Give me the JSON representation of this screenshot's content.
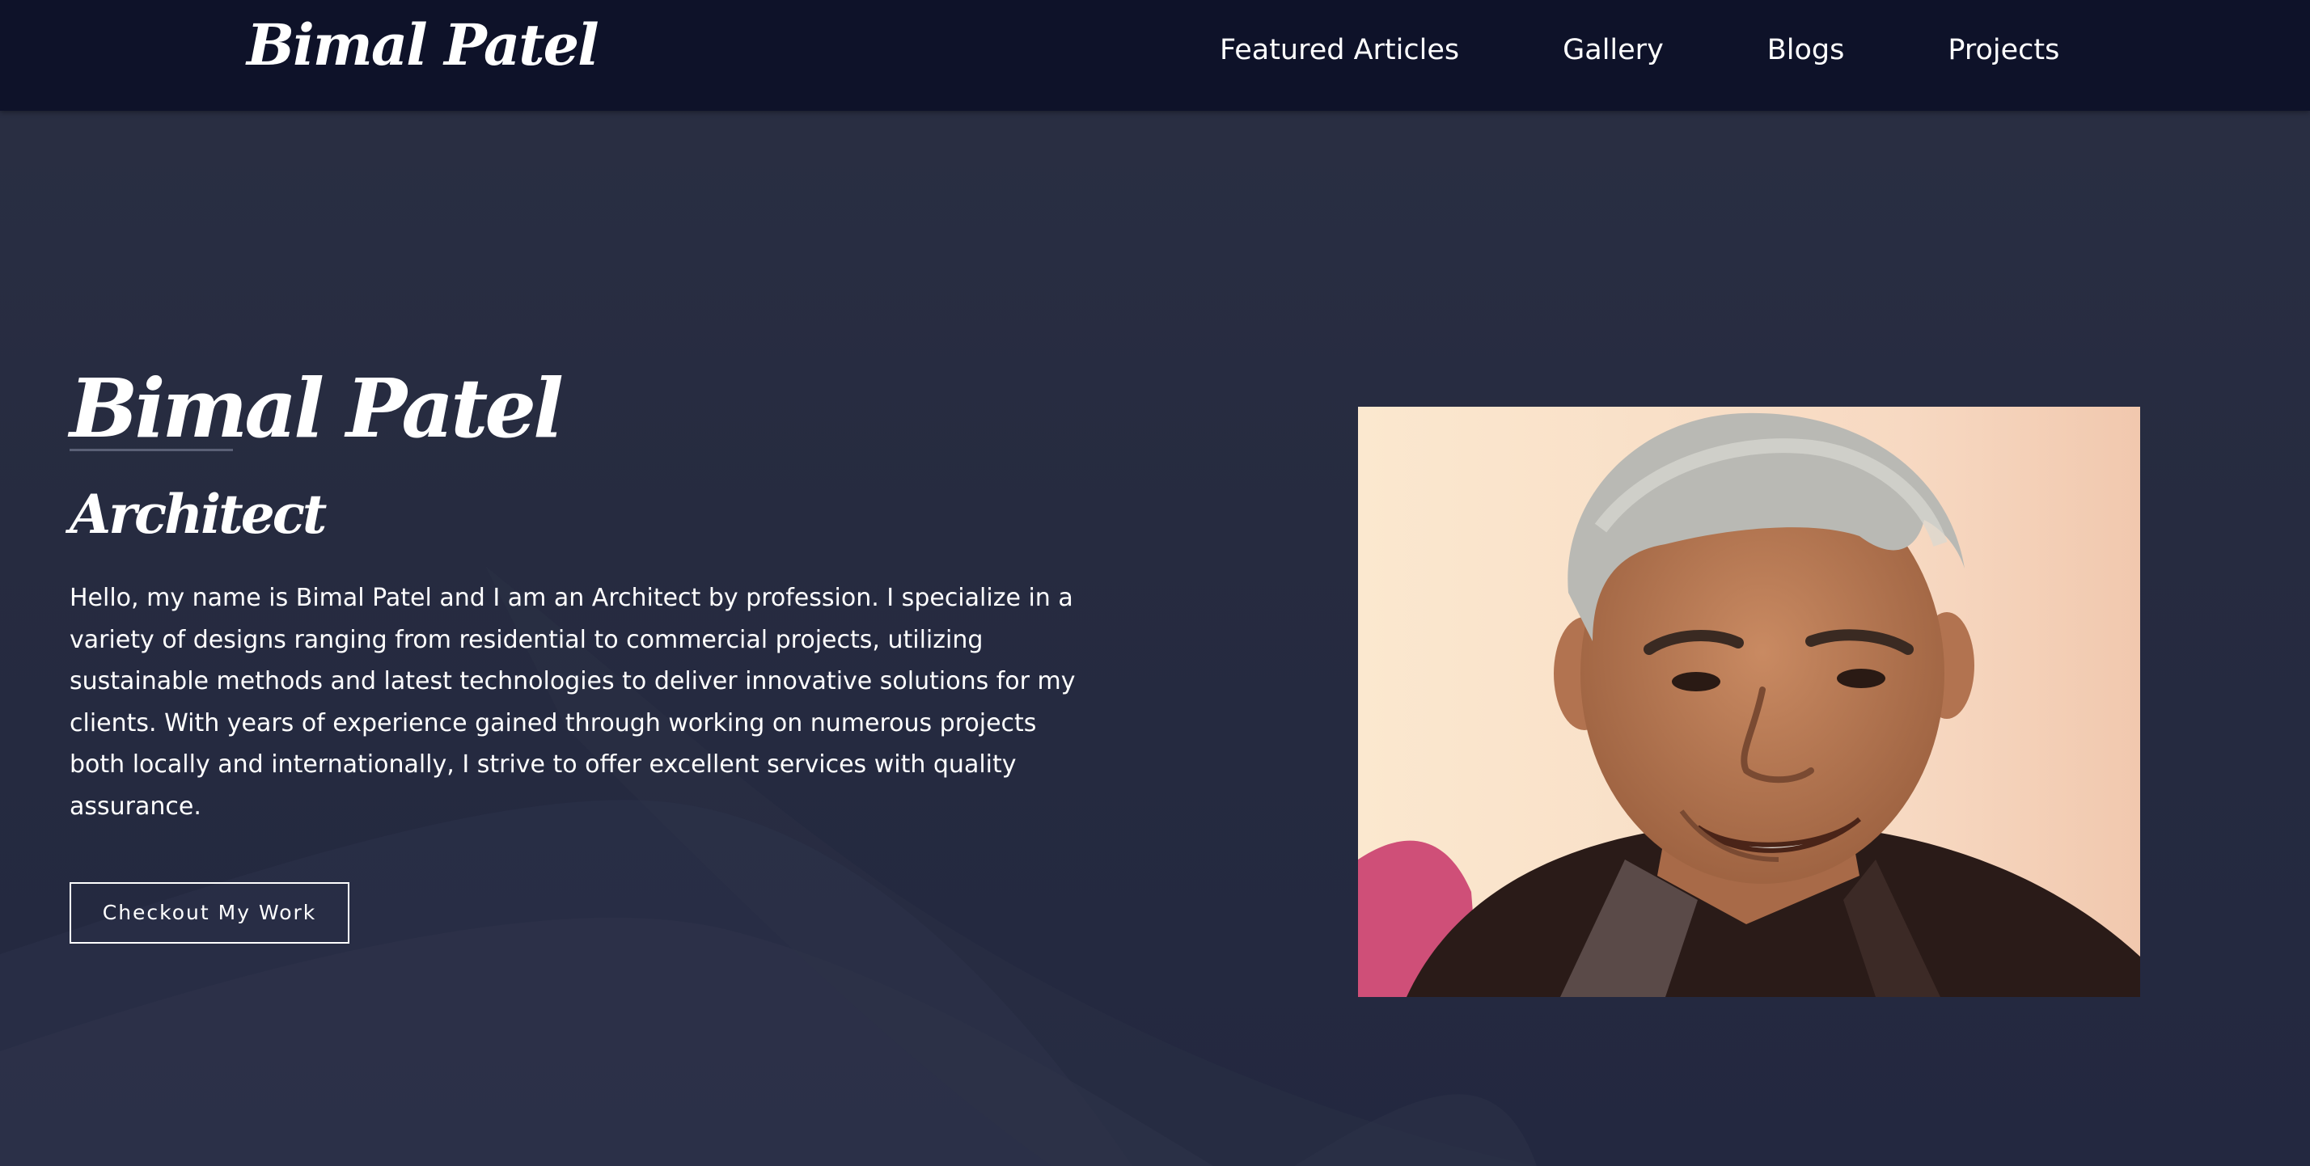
{
  "nav": {
    "brand": "Bimal Patel",
    "links": [
      {
        "label": "Featured Articles"
      },
      {
        "label": "Gallery"
      },
      {
        "label": "Blogs"
      },
      {
        "label": "Projects"
      }
    ]
  },
  "hero": {
    "title": "Bimal Patel",
    "subtitle": "Architect",
    "bio": "Hello, my name is Bimal Patel and I am an Architect by profession. I specialize in a variety of designs ranging from residential to commercial projects, utilizing sustainable methods and latest technologies to deliver innovative solutions for my clients. With years of experience gained through working on numerous projects both locally and internationally, I strive to offer excellent services with quality assurance.",
    "cta_label": "Checkout My Work"
  },
  "colors": {
    "navbar_bg": "#0e1229",
    "page_bg": "#262b40",
    "text": "#ffffff"
  }
}
